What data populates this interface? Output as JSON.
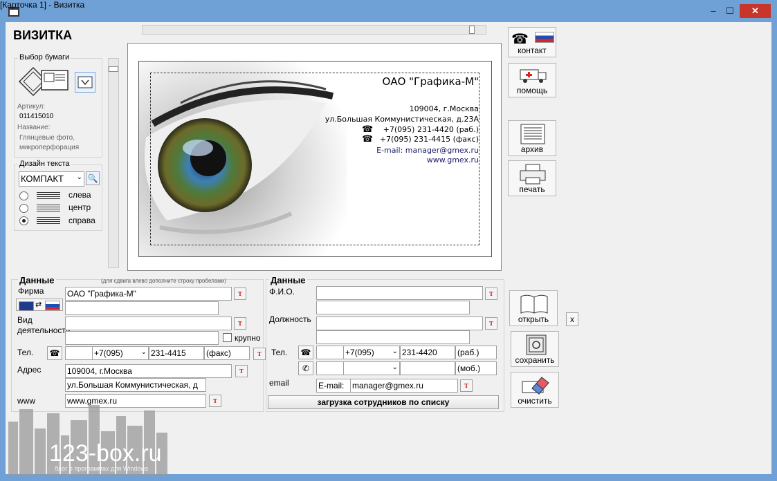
{
  "window": {
    "title": "[Карточка 1] - Визитка",
    "minimize": "–",
    "maximize": "☐",
    "close": "✕"
  },
  "app": {
    "heading": "ВИЗИТКА"
  },
  "paper": {
    "group_label": "Выбор бумаги",
    "article_label": "Артикул:",
    "article_value": "011415010",
    "name_label": "Название:",
    "name_value": "Глянцевые фото, микроперфорация"
  },
  "design": {
    "group_label": "Дизайн текста",
    "style_selected": "КОМПАКТ",
    "align_options": [
      {
        "label": "слева",
        "checked": false
      },
      {
        "label": "центр",
        "checked": false
      },
      {
        "label": "справа",
        "checked": true
      }
    ]
  },
  "card": {
    "company": "ОАО \"Графика-М\"",
    "line1": "109004, г.Москва",
    "line2": "ул.Большая Коммунистическая, д.23А",
    "phone1": "+7(095) 231-4420 (раб.)",
    "phone2": "+7(095) 231-4415 (факс)",
    "email": "E-mail: manager@gmex.ru",
    "site": "www.gmex.ru"
  },
  "side_buttons": {
    "contact": "контакт",
    "help": "помощь",
    "archive": "архив",
    "print": "печать",
    "open": "открыть",
    "save": "сохранить",
    "clear": "очистить",
    "x": "x"
  },
  "form_left": {
    "title": "Данные",
    "hint": "(для сдвига влево дополните строку пробелами)",
    "firm_label": "Фирма",
    "firm_value": "ОАО \"Графика-М\"",
    "activity_label": "Вид деятельности",
    "activity_value": "",
    "large_label": "крупно",
    "phone_label": "Тел.",
    "phone_prefix": "+7(095)",
    "phone_number": "231-4415",
    "phone_type": "(факс)",
    "address_label": "Адрес",
    "address1": "109004, г.Москва",
    "address2": "ул.Большая Коммунистическая, д",
    "www_label": "www",
    "www_value": "www.gmex.ru"
  },
  "form_right": {
    "title": "Данные",
    "fio_label": "Ф.И.О.",
    "position_label": "Должность",
    "phone_label": "Тел.",
    "phone_prefix": "+7(095)",
    "phone_number": "231-4420",
    "phone_type": "(раб.)",
    "phone2_type": "(моб.)",
    "email_label": "email",
    "email_prefix": "E-mail:",
    "email_value": "manager@gmex.ru",
    "load_button": "загрузка сотрудников по списку"
  },
  "tbtn_label": "T",
  "watermark": {
    "brand": "123-box.ru",
    "tagline": "блог о программах для Windows"
  }
}
